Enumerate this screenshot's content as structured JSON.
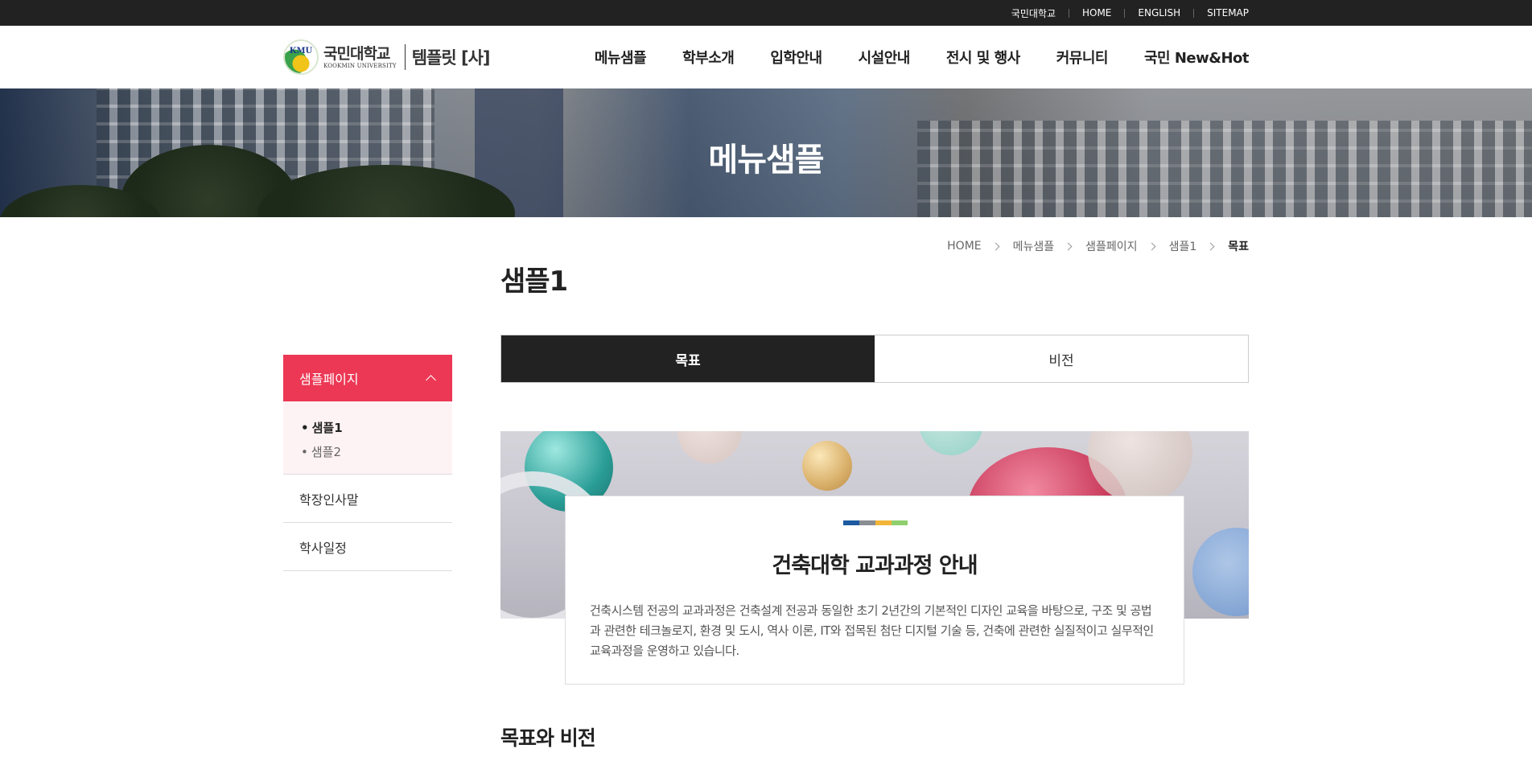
{
  "topbar": {
    "links": [
      "국민대학교",
      "HOME",
      "ENGLISH",
      "SITEMAP"
    ]
  },
  "header": {
    "logo_emblem": "KMU",
    "logo_kr": "국민대학교",
    "logo_en": "KOOKMIN UNIVERSITY",
    "logo_sub": "템플릿 [사]",
    "nav": [
      "메뉴샘플",
      "학부소개",
      "입학안내",
      "시설안내",
      "전시 및 행사",
      "커뮤니티",
      "국민 New&Hot"
    ]
  },
  "hero": {
    "title": "메뉴샘플"
  },
  "breadcrumb": [
    "HOME",
    "메뉴샘플",
    "샘플페이지",
    "샘플1",
    "목표"
  ],
  "page": {
    "title": "샘플1"
  },
  "sidebar": {
    "head": "샘플페이지",
    "sub_items": [
      "샘플1",
      "샘플2"
    ],
    "items": [
      "학장인사말",
      "학사일정"
    ]
  },
  "tabs": [
    "목표",
    "비전"
  ],
  "card": {
    "title": "건축대학 교과과정 안내",
    "description": "건축시스템 전공의 교과과정은 건축설계 전공과 동일한 초기 2년간의 기본적인 디자인 교육을 바탕으로, 구조 및 공법과 관련한 테크놀로지, 환경 및 도시, 역사 이론, IT와 접목된 첨단 디지털 기술 등, 건축에 관련한 실질적이고 실무적인 교육과정을 운영하고 있습니다.",
    "bar_colors": [
      "#1d5aa0",
      "#8a8d92",
      "#f2b53a",
      "#8fcf6e"
    ]
  },
  "section": {
    "title": "목표와 비전"
  },
  "colors": {
    "accent": "#ec3855",
    "dark": "#222222"
  }
}
